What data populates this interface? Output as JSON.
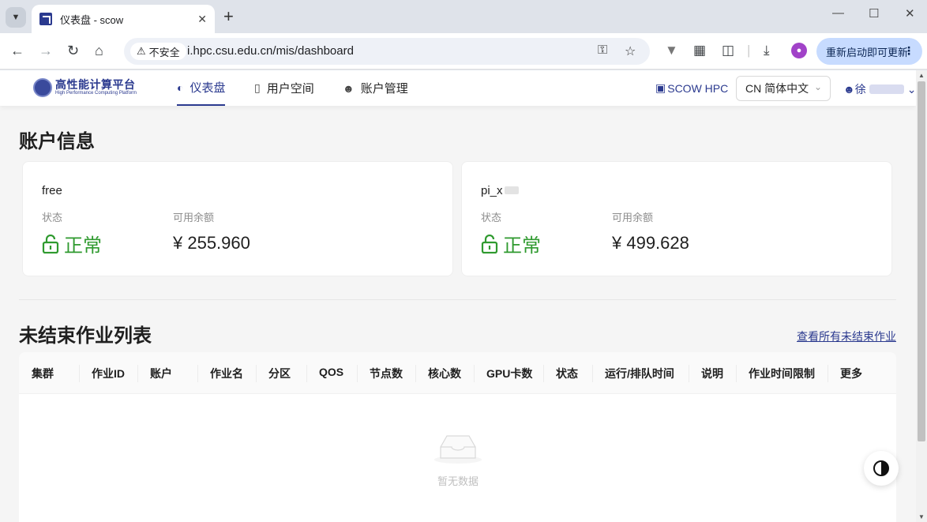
{
  "browser": {
    "tab_title": "仪表盘 - scow",
    "new_tab": "+",
    "security_label": "不安全",
    "url": "i.hpc.csu.edu.cn/mis/dashboard",
    "update_button": "重新启动即可更新"
  },
  "header": {
    "logo_cn": "高性能计算平台",
    "logo_en": "High Performance Computing Platform",
    "menu": [
      {
        "label": "仪表盘"
      },
      {
        "label": "用户空间"
      },
      {
        "label": "账户管理"
      }
    ],
    "scow_link": "SCOW HPC",
    "language": "CN 简体中文",
    "user_initial": "徐"
  },
  "account_section": {
    "title": "账户信息",
    "status_label": "状态",
    "balance_label": "可用余额",
    "accounts": [
      {
        "name": "free",
        "status": "正常",
        "balance": "¥ 255.960"
      },
      {
        "name": "pi_x",
        "status": "正常",
        "balance": "¥ 499.628"
      }
    ]
  },
  "jobs_section": {
    "title": "未结束作业列表",
    "view_all": "查看所有未结束作业",
    "columns": [
      "集群",
      "作业ID",
      "账户",
      "作业名",
      "分区",
      "QOS",
      "节点数",
      "核心数",
      "GPU卡数",
      "状态",
      "运行/排队时间",
      "说明",
      "作业时间限制",
      "更多"
    ],
    "empty_text": "暂无数据"
  },
  "colors": {
    "brand": "#2b3a8f",
    "status_ok": "#2f9a2f"
  }
}
